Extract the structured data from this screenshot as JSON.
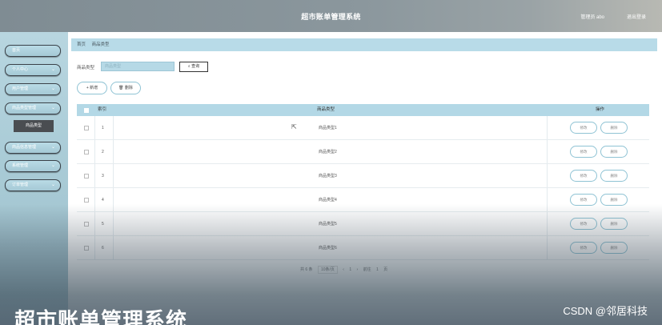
{
  "header": {
    "app_title": "超市账单管理系统",
    "admin_label": "管理员 abo",
    "logout_label": "退出登录"
  },
  "sidebar": {
    "items": [
      {
        "label": "首页",
        "has_chevron": false
      },
      {
        "label": "个人中心",
        "has_chevron": true
      },
      {
        "label": "用户管理",
        "has_chevron": true
      },
      {
        "label": "商品类型管理",
        "has_chevron": true
      },
      {
        "label": "商品信息管理",
        "has_chevron": true
      },
      {
        "label": "系统管理",
        "has_chevron": true
      },
      {
        "label": "订单管理",
        "has_chevron": true
      }
    ],
    "active_submenu": "商品类型"
  },
  "breadcrumb": [
    "首页",
    "商品类型"
  ],
  "search": {
    "label": "商品类型",
    "placeholder": "商品类型",
    "button_label": "查询"
  },
  "actions": {
    "add_label": "+ 新增",
    "delete_label": "删除"
  },
  "table": {
    "headers": {
      "index": "索引",
      "type": "商品类型",
      "ops": "操作"
    },
    "rows": [
      {
        "index": "1",
        "type": "商品类型1"
      },
      {
        "index": "2",
        "type": "商品类型2"
      },
      {
        "index": "3",
        "type": "商品类型3"
      },
      {
        "index": "4",
        "type": "商品类型4"
      },
      {
        "index": "5",
        "type": "商品类型5"
      },
      {
        "index": "6",
        "type": "商品类型6"
      }
    ],
    "edit_label": "修改",
    "delete_label": "删除"
  },
  "pagination": {
    "total": "共 6 条",
    "page_size": "10条/页",
    "prev": "‹",
    "current_page": "1",
    "next": "›",
    "goto_label": "前往",
    "goto_value": "1",
    "page_suffix": "页"
  },
  "overlay": {
    "title": "超市账单管理系统",
    "credit": "CSDN @邻居科技"
  },
  "colors": {
    "header": "#8b979d",
    "sidebar": "#a9cbd6",
    "breadcrumb": "#b8dbe8",
    "table_header": "#b3d8e6",
    "active_submenu": "#4a4d51"
  }
}
